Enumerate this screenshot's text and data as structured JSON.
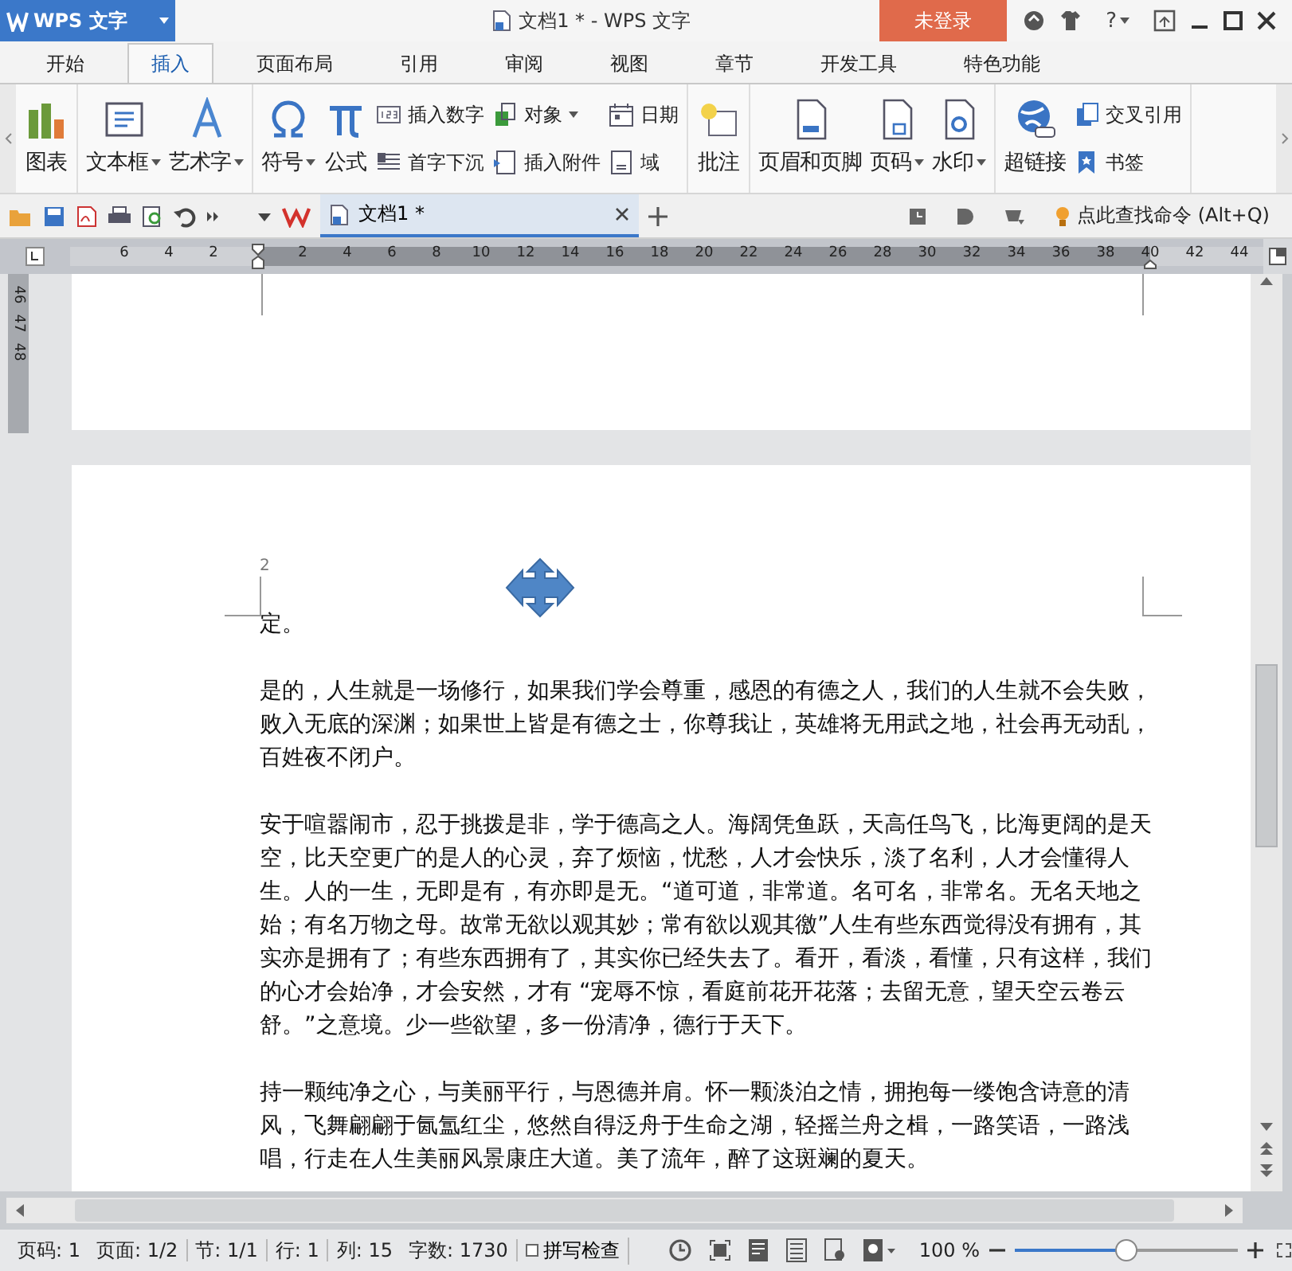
{
  "title_bar": {
    "app_button": "WPS 文字",
    "title": "文档1 * - WPS 文字",
    "login_button": "未登录",
    "help": "?"
  },
  "tabs": [
    {
      "label": "开始",
      "selected": false
    },
    {
      "label": "插入",
      "selected": true
    },
    {
      "label": "页面布局",
      "selected": false
    },
    {
      "label": "引用",
      "selected": false
    },
    {
      "label": "审阅",
      "selected": false
    },
    {
      "label": "视图",
      "selected": false
    },
    {
      "label": "章节",
      "selected": false
    },
    {
      "label": "开发工具",
      "selected": false
    },
    {
      "label": "特色功能",
      "selected": false
    }
  ],
  "ribbon": {
    "groups": [
      {
        "items": [
          {
            "kind": "large",
            "label": "图表",
            "dropdown": false
          }
        ]
      },
      {
        "items": [
          {
            "kind": "large",
            "label": "文本框",
            "dropdown": true
          },
          {
            "kind": "large",
            "label": "艺术字",
            "dropdown": true
          }
        ]
      },
      {
        "items": [
          {
            "kind": "large",
            "label": "符号",
            "dropdown": true
          },
          {
            "kind": "large",
            "label": "公式",
            "dropdown": false
          },
          {
            "kind": "stack",
            "items": [
              {
                "label": "插入数字",
                "dropdown": false
              },
              {
                "label": "首字下沉",
                "dropdown": false
              }
            ]
          },
          {
            "kind": "stack",
            "items": [
              {
                "label": "对象",
                "dropdown": true
              },
              {
                "label": "插入附件",
                "dropdown": false
              }
            ]
          },
          {
            "kind": "stack",
            "items": [
              {
                "label": "日期",
                "dropdown": false
              },
              {
                "label": "域",
                "dropdown": false
              }
            ]
          }
        ]
      },
      {
        "items": [
          {
            "kind": "large",
            "label": "批注",
            "dropdown": false
          }
        ]
      },
      {
        "items": [
          {
            "kind": "large",
            "label": "页眉和页脚",
            "dropdown": false
          },
          {
            "kind": "large",
            "label": "页码",
            "dropdown": true
          },
          {
            "kind": "large",
            "label": "水印",
            "dropdown": true
          }
        ]
      },
      {
        "items": [
          {
            "kind": "large",
            "label": "超链接",
            "dropdown": false
          },
          {
            "kind": "stack",
            "items": [
              {
                "label": "交叉引用",
                "dropdown": false
              },
              {
                "label": "书签",
                "dropdown": false
              }
            ]
          }
        ]
      }
    ]
  },
  "quick_bar": {
    "doc_tab": {
      "label": "文档1 *",
      "selected": true
    },
    "command_search": "点此查找命令 (Alt+Q)"
  },
  "ruler": {
    "ticks": [
      "6",
      "4",
      "2",
      "2",
      "4",
      "6",
      "8",
      "10",
      "12",
      "14",
      "16",
      "18",
      "20",
      "22",
      "24",
      "26",
      "28",
      "30",
      "32",
      "34",
      "36",
      "38",
      "40",
      "42",
      "44"
    ]
  },
  "vertical_ruler": {
    "ticks": [
      "46",
      "47",
      "48"
    ]
  },
  "document": {
    "page_number": "2",
    "paragraphs": [
      "定。",
      "是的，人生就是一场修行，如果我们学会尊重，感恩的有德之人，我们的人生就不会失败，败入无底的深渊；如果世上皆是有德之士，你尊我让，英雄将无用武之地，社会再无动乱，百姓夜不闭户。",
      "安于喧嚣闹市，忍于挑拨是非，学于德高之人。海阔凭鱼跃，天高任鸟飞，比海更阔的是天空，比天空更广的是人的心灵，弃了烦恼，忧愁，人才会快乐，淡了名利，人才会懂得人生。人的一生，无即是有，有亦即是无。“道可道，非常道。名可名，非常名。无名天地之始；有名万物之母。故常无欲以观其妙；常有欲以观其徼”人生有些东西觉得没有拥有，其实亦是拥有了；有些东西拥有了，其实你已经失去了。看开，看淡，看懂，只有这样，我们的心才会始净，才会安然，才有 “宠辱不惊，看庭前花开花落；去留无意，望天空云卷云舒。”之意境。少一些欲望，多一份清净，德行于天下。",
      "持一颗纯净之心，与美丽平行，与恩德并肩。怀一颗淡泊之情，拥抱每一缕饱含诗意的清风，飞舞翩翩于氤氲红尘，悠然自得泛舟于生命之湖，轻摇兰舟之楫，一路笑语，一路浅唱，行走在人生美丽风景康庄大道。美了流年，醉了这斑斓的夏天。"
    ]
  },
  "status_bar": {
    "fields": [
      "页码: 1",
      "页面: 1/2",
      "节: 1/1",
      "行: 1",
      "列: 15",
      "字数: 1730"
    ],
    "spell_check": {
      "label": "拼写检查",
      "checked": false
    },
    "zoom": {
      "reading": "100 %",
      "level": 0.5
    }
  }
}
